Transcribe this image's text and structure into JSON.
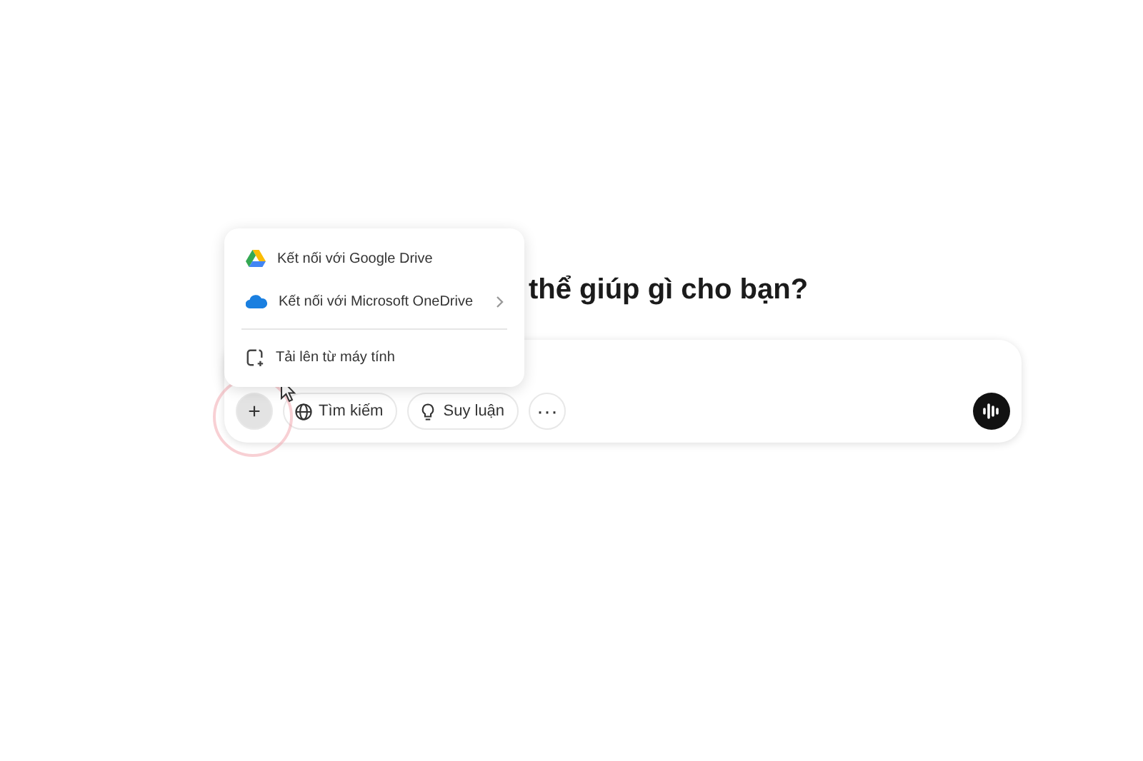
{
  "heading": "thể giúp gì cho bạn?",
  "menu": {
    "items": [
      {
        "kind": "gdrive",
        "label": "Kết nối với Google Drive",
        "submenu": false
      },
      {
        "kind": "onedrive",
        "label": "Kết nối với Microsoft OneDrive",
        "submenu": true
      },
      {
        "kind": "divider"
      },
      {
        "kind": "upload",
        "label": "Tải lên từ máy tính",
        "submenu": false
      }
    ]
  },
  "composer": {
    "tools": [
      {
        "kind": "add",
        "label": "+",
        "pressed": true
      },
      {
        "kind": "search",
        "label": "Tìm kiếm"
      },
      {
        "kind": "reason",
        "label": "Suy luận"
      },
      {
        "kind": "more",
        "label": "···"
      }
    ]
  }
}
